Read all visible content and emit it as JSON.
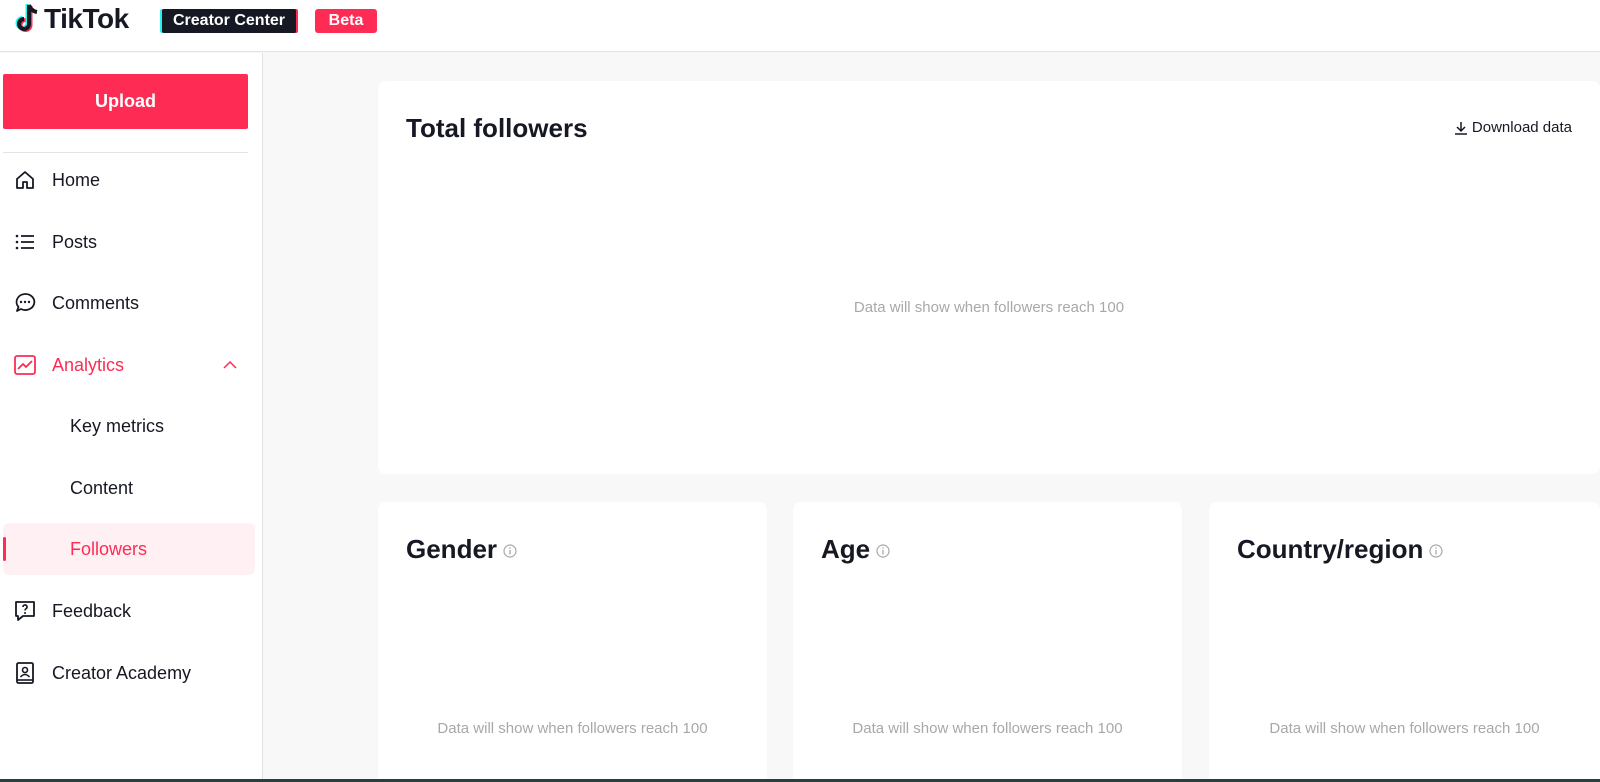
{
  "header": {
    "brand": "TikTok",
    "section_badge": "Creator Center",
    "beta_badge": "Beta"
  },
  "sidebar": {
    "upload_label": "Upload",
    "items": [
      {
        "label": "Home",
        "icon": "home-icon"
      },
      {
        "label": "Posts",
        "icon": "list-icon"
      },
      {
        "label": "Comments",
        "icon": "comment-icon"
      },
      {
        "label": "Analytics",
        "icon": "analytics-icon",
        "expanded": true
      },
      {
        "label": "Key metrics"
      },
      {
        "label": "Content"
      },
      {
        "label": "Followers",
        "selected": true
      },
      {
        "label": "Feedback",
        "icon": "feedback-icon"
      },
      {
        "label": "Creator Academy",
        "icon": "academy-icon"
      }
    ]
  },
  "main": {
    "total_followers": {
      "title": "Total followers",
      "download_label": "Download data",
      "empty_message": "Data will show when followers reach 100"
    },
    "gender": {
      "title": "Gender",
      "empty_message": "Data will show when followers reach 100"
    },
    "age": {
      "title": "Age",
      "empty_message": "Data will show when followers reach 100"
    },
    "country": {
      "title": "Country/region",
      "empty_message": "Data will show when followers reach 100"
    }
  },
  "colors": {
    "accent": "#fe2c55",
    "text": "#161823",
    "muted": "#a8a8ab",
    "background": "#f8f8f8"
  }
}
